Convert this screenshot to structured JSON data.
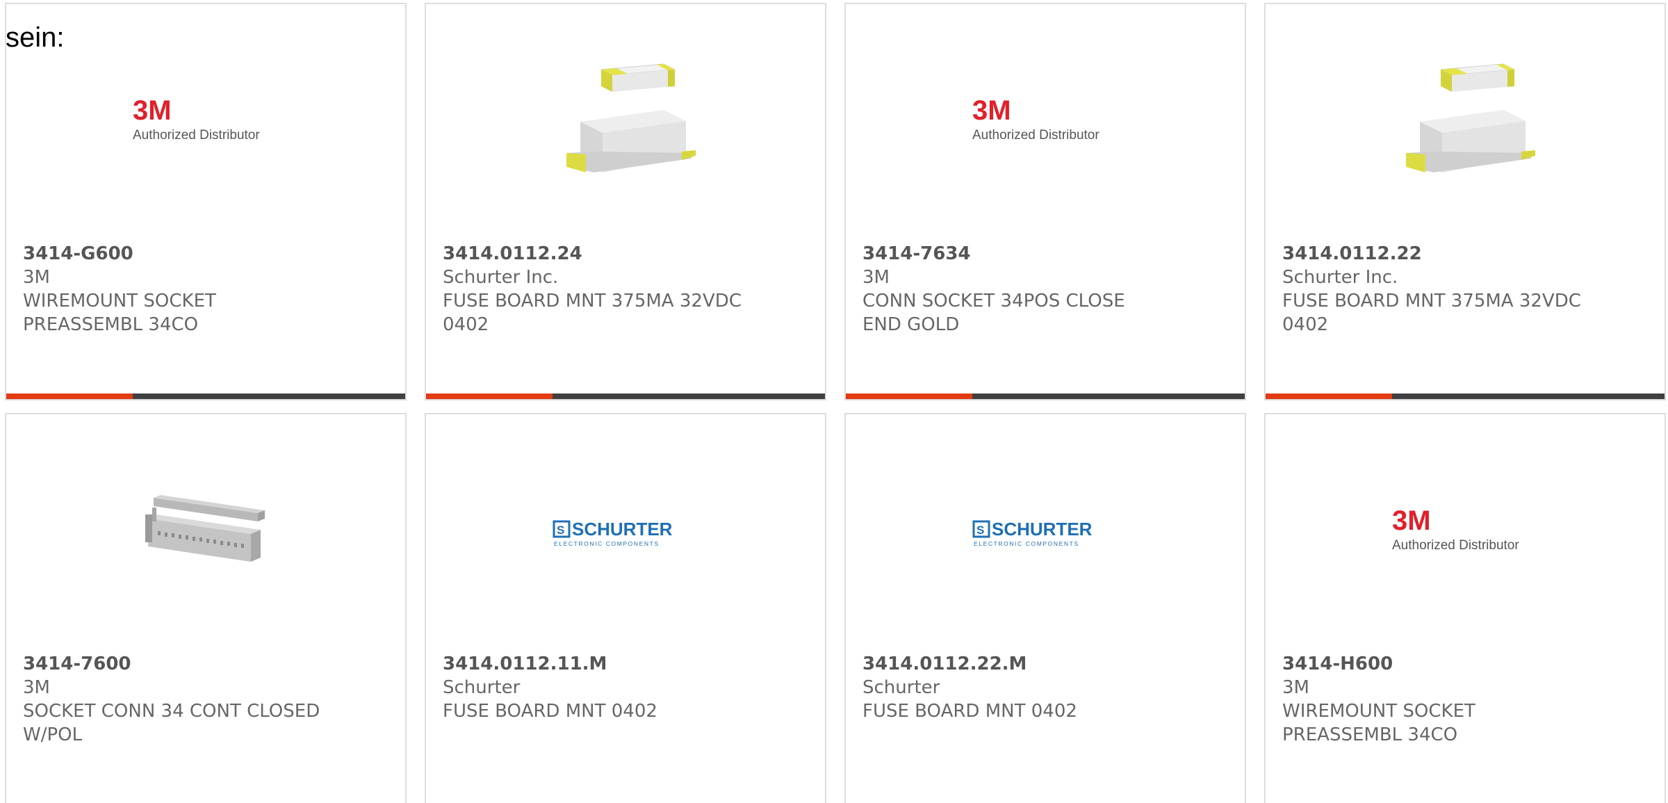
{
  "lead_text": "sein:",
  "colors": {
    "card_border": "#dddddd",
    "bar_dark": "#404040",
    "bar_accent": "#e23b12",
    "text": "#666666",
    "logo_3m_red": "#e0202a",
    "logo_schurter_blue": "#1f6fb5"
  },
  "products": [
    {
      "part_number": "3414-G600",
      "manufacturer": "3M",
      "description": "WIREMOUNT SOCKET PREASSEMBL 34CO",
      "image": "3m-authorized-distributor-logo",
      "logo_text": "3M",
      "logo_caption": "Authorized Distributor"
    },
    {
      "part_number": "3414.0112.24",
      "manufacturer": "Schurter Inc.",
      "description": "FUSE BOARD MNT 375MA 32VDC 0402",
      "image": "smd-fuse-photo"
    },
    {
      "part_number": "3414-7634",
      "manufacturer": "3M",
      "description": "CONN SOCKET 34POS CLOSE END GOLD",
      "image": "3m-authorized-distributor-logo",
      "logo_text": "3M",
      "logo_caption": "Authorized Distributor"
    },
    {
      "part_number": "3414.0112.22",
      "manufacturer": "Schurter Inc.",
      "description": "FUSE BOARD MNT 375MA 32VDC 0402",
      "image": "smd-fuse-photo"
    },
    {
      "part_number": "3414-7600",
      "manufacturer": "3M",
      "description": "SOCKET CONN 34 CONT CLOSED W/POL",
      "image": "ribbon-socket-connector-photo"
    },
    {
      "part_number": "3414.0112.11.M",
      "manufacturer": "Schurter",
      "description": "FUSE BOARD MNT 0402",
      "image": "schurter-logo",
      "logo_text": "SCHURTER",
      "logo_caption": "ELECTRONIC COMPONENTS"
    },
    {
      "part_number": "3414.0112.22.M",
      "manufacturer": "Schurter",
      "description": "FUSE BOARD MNT 0402",
      "image": "schurter-logo",
      "logo_text": "SCHURTER",
      "logo_caption": "ELECTRONIC COMPONENTS"
    },
    {
      "part_number": "3414-H600",
      "manufacturer": "3M",
      "description": "WIREMOUNT SOCKET PREASSEMBL 34CO",
      "image": "3m-authorized-distributor-logo",
      "logo_text": "3M",
      "logo_caption": "Authorized Distributor"
    }
  ]
}
